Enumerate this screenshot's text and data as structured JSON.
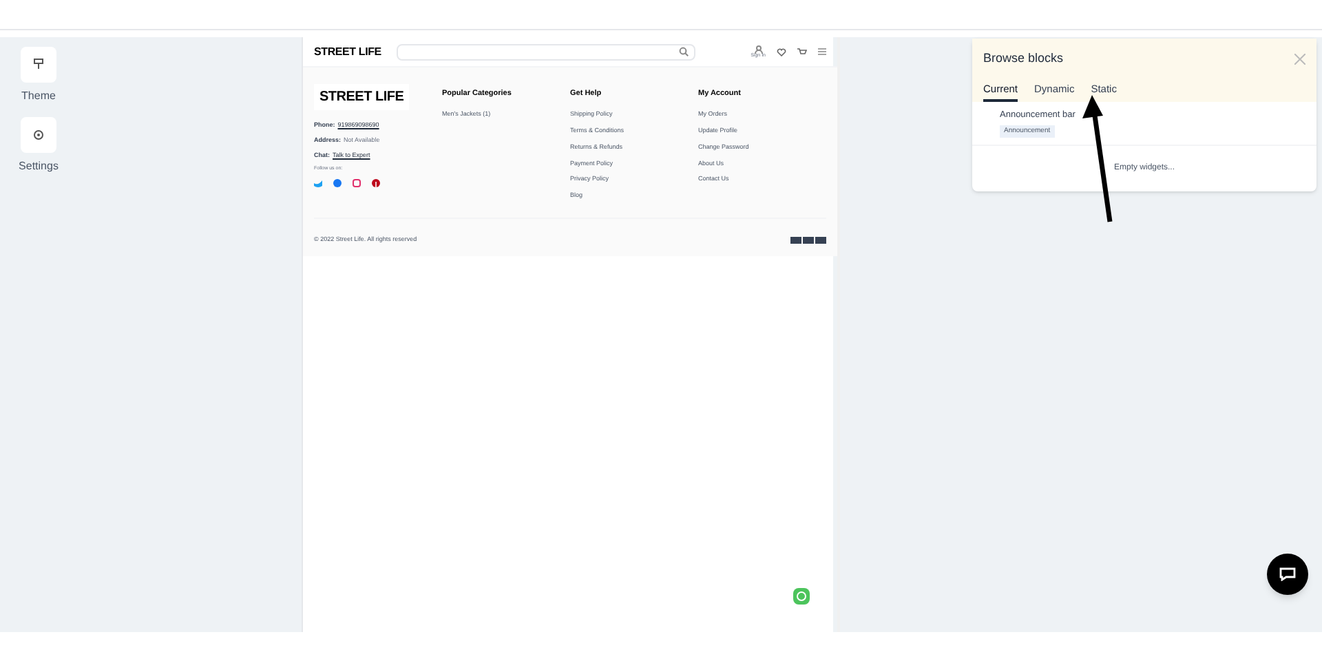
{
  "sidebar": {
    "items": [
      {
        "label": "Theme"
      },
      {
        "label": "Settings"
      }
    ]
  },
  "preview": {
    "header": {
      "logo": "STREET LIFE",
      "account_label": "Sign In"
    },
    "footer": {
      "logo": "STREET LIFE",
      "contact": [
        {
          "label": "Phone:",
          "value": "919869098690",
          "link": true
        },
        {
          "label": "Address:",
          "value": "Not Available",
          "link": false
        },
        {
          "label": "Chat:",
          "value": "Talk to Expert",
          "link": true
        }
      ],
      "follow_label": "Follow us on:",
      "social": [
        {
          "kind": "twitter",
          "color": "#1da1f2"
        },
        {
          "kind": "facebook",
          "color": "#1877f2"
        },
        {
          "kind": "instagram",
          "color": "#e1306c"
        },
        {
          "kind": "pinterest",
          "color": "#bd081c"
        }
      ],
      "columns": [
        {
          "title": "Popular Categories",
          "links": [
            "Men's Jackets (1)"
          ]
        },
        {
          "title": "Get Help",
          "links": [
            "Shipping Policy",
            "Terms & Conditions",
            "Returns & Refunds",
            "Payment Policy",
            "Privacy Policy",
            "Blog"
          ]
        },
        {
          "title": "My Account",
          "links": [
            "My Orders",
            "Update Profile",
            "Change Password",
            "About Us",
            "Contact Us"
          ]
        }
      ],
      "copyright": "© 2022 Street Life. All rights reserved"
    }
  },
  "panel": {
    "title": "Browse blocks",
    "tabs": [
      {
        "label": "Current",
        "selected": true
      },
      {
        "label": "Dynamic",
        "selected": false
      },
      {
        "label": "Static",
        "selected": false
      }
    ],
    "blocks": [
      {
        "name": "Announcement bar",
        "tag": "Announcement"
      }
    ],
    "empty_text": "Empty widgets..."
  }
}
